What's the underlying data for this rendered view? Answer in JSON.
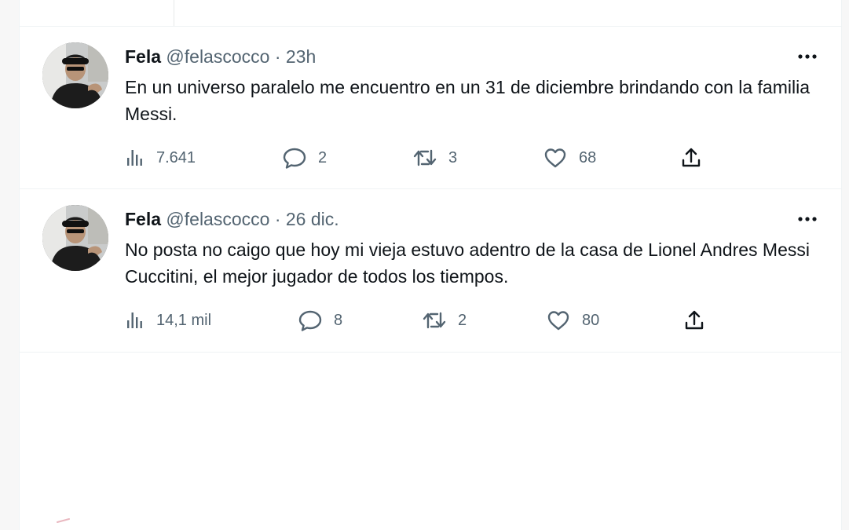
{
  "colors": {
    "text_primary": "#0f1419",
    "text_secondary": "#536471",
    "divider": "#eff3f4"
  },
  "tweets": [
    {
      "name": "Fela",
      "handle": "@felascocco",
      "separator": "·",
      "time": "23h",
      "text": "En un universo paralelo me encuentro en un 31 de diciembre brindando con la familia Messi.",
      "views": "7.641",
      "replies": "2",
      "retweets": "3",
      "likes": "68"
    },
    {
      "name": "Fela",
      "handle": "@felascocco",
      "separator": "·",
      "time": "26 dic.",
      "text": "No posta no caigo que hoy mi vieja estuvo adentro de la casa de Lionel Andres Messi Cuccitini, el mejor jugador de todos los tiempos.",
      "views": "14,1 mil",
      "replies": "8",
      "retweets": "2",
      "likes": "80"
    }
  ],
  "icons": {
    "views": "analytics-icon",
    "reply": "speech-bubble-icon",
    "retweet": "retweet-icon",
    "like": "heart-icon",
    "share": "share-icon",
    "more": "more-dots-icon"
  }
}
